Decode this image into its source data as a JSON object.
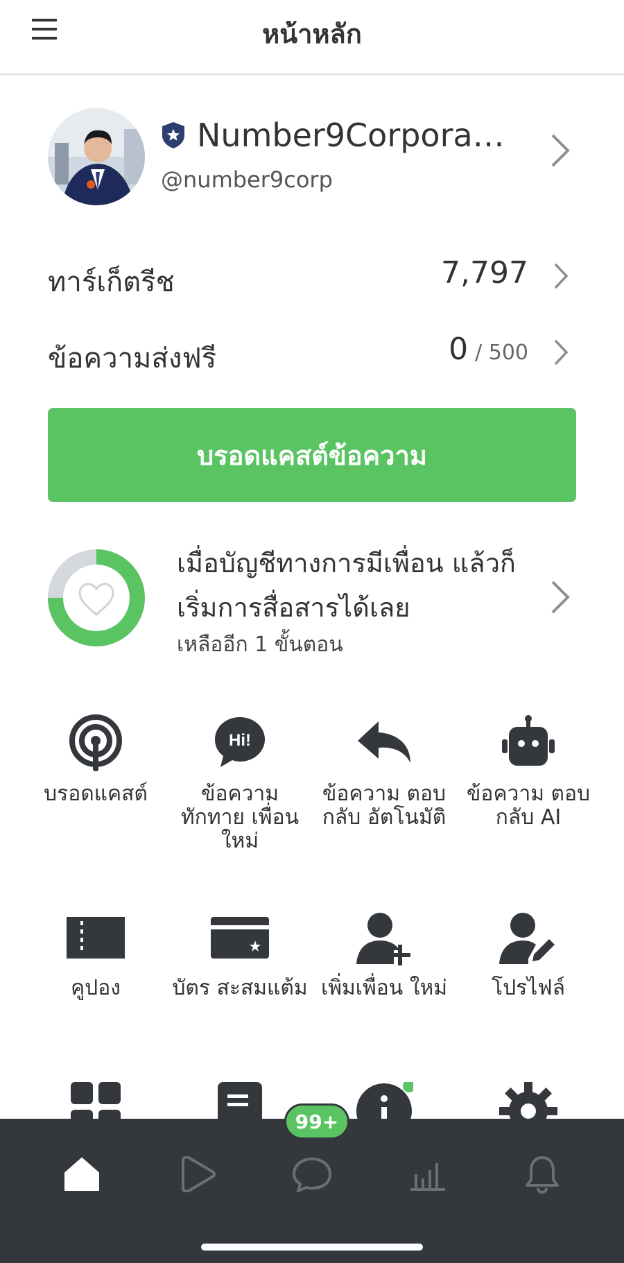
{
  "header": {
    "title": "หน้าหลัก"
  },
  "profile": {
    "name": "Number9Corporati...",
    "id": "@number9corp"
  },
  "stats": {
    "target_reach_label": "ทาร์เก็ตรีช",
    "target_reach_value": "7,797",
    "free_messages_label": "ข้อความส่งฟรี",
    "free_messages_used": "0",
    "free_messages_limit": "/ 500"
  },
  "broadcast_button": "บรอดแคสต์ข้อความ",
  "friends_progress": {
    "title": "เมื่อบัญชีทางการมีเพื่อน แล้วก็เริ่มการสื่อสารได้เลย",
    "subtitle": "เหลืออีก 1 ขั้นตอน",
    "progress_fraction": 0.75
  },
  "grid": {
    "broadcast": "บรอดแคสต์",
    "greeting": "ข้อความ ทักทาย เพื่อนใหม่",
    "auto_reply": "ข้อความ ตอบกลับ อัตโนมัติ",
    "ai_reply": "ข้อความ ตอบกลับ AI",
    "coupon": "คูปอง",
    "reward_card": "บัตร สะสมแต้ม",
    "add_friend": "เพิ่มเพื่อน ใหม่",
    "profile": "โปรไฟล์"
  },
  "bottom_nav": {
    "badge": "99+"
  },
  "colors": {
    "accent": "#5ac463",
    "nav_bg": "#34373c",
    "icon_dark": "#34373c"
  }
}
